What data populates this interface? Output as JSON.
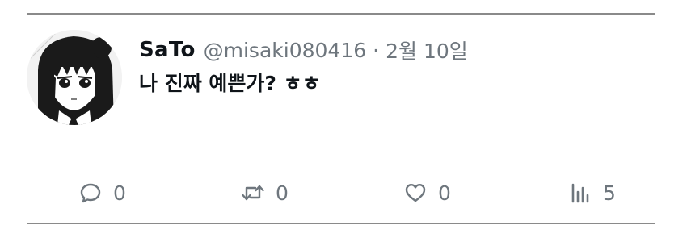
{
  "tweet": {
    "display_name": "SaTo",
    "handle": "@misaki080416",
    "separator": "·",
    "date": "2월 10일",
    "text": "나 진짜 예쁜가? ㅎㅎ",
    "avatar_icon": "manga-girl-avatar"
  },
  "actions": {
    "reply": {
      "icon": "reply-icon",
      "count": "0"
    },
    "retweet": {
      "icon": "retweet-icon",
      "count": "0"
    },
    "like": {
      "icon": "heart-icon",
      "count": "0"
    },
    "views": {
      "icon": "views-chart-icon",
      "count": "5"
    }
  },
  "colors": {
    "text_primary": "#0f1419",
    "text_secondary": "#6e767d",
    "divider": "#8a8a8a"
  }
}
